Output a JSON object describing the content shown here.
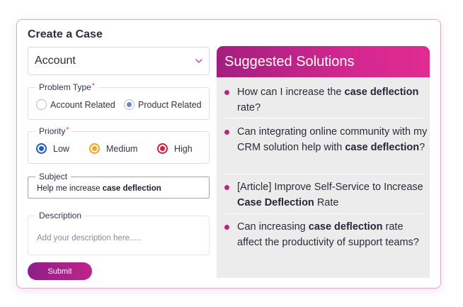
{
  "form": {
    "title": "Create a Case",
    "account_select": "Account",
    "problem_type": {
      "legend": "Problem Type",
      "required_mark": "*",
      "options": [
        "Account Related",
        "Product Related"
      ],
      "selected": "Product Related"
    },
    "priority": {
      "legend": "Priority",
      "required_mark": "*",
      "options": [
        "Low",
        "Medium",
        "High"
      ],
      "selected": "Low",
      "colors": {
        "low": "#1f5cc7",
        "medium": "#f0a324",
        "high": "#d01e3c"
      }
    },
    "subject": {
      "legend": "Subject",
      "value_plain": "Help me increase ",
      "value_bold": "case deflection"
    },
    "description": {
      "legend": "Description",
      "placeholder": "Add your description here....."
    },
    "submit_label": "Submit"
  },
  "solutions": {
    "title": "Suggested Solutions",
    "accent_color": "#c51f84",
    "items": [
      {
        "a": "How can I increase the ",
        "b": "case deflection",
        "c": " rate?"
      },
      {
        "a": "Can integrating online community with my CRM solution help with ",
        "b": "case deflection",
        "c": "?"
      },
      {
        "a": "[Article] Improve Self-Service to Increase ",
        "b": "Case Deflection",
        "c": " Rate"
      },
      {
        "a": "Can increasing ",
        "b": "case deflection",
        "c": " rate affect the productivity of support teams?"
      }
    ]
  }
}
